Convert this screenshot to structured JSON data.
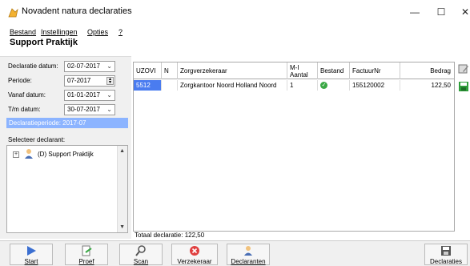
{
  "window": {
    "title": "Novadent natura declaraties",
    "minimize": "—",
    "maximize": "☐",
    "close": "✕"
  },
  "menu": {
    "items": [
      "Bestand",
      "Instellingen",
      "Opties",
      "?"
    ]
  },
  "page": {
    "title": "Support Praktijk"
  },
  "form": {
    "declaratie_datum_label": "Declaratie datum:",
    "declaratie_datum_value": "02-07-2017",
    "periode_label": "Periode:",
    "periode_value": "07-2017",
    "vanaf_datum_label": "Vanaf datum:",
    "vanaf_datum_value": "01-01-2017",
    "tm_datum_label": "T/m datum:",
    "tm_datum_value": "30-07-2017",
    "declaratieperiode": "Declaratieperiode: 2017-07",
    "select_label": "Selecteer declarant:",
    "tree_plus": "+",
    "tree_item": "(D) Support Praktijk"
  },
  "grid": {
    "headers": [
      "UZOVI",
      "N",
      "Zorgverzekeraar",
      "M-I Aantal",
      "Bestand",
      "FactuurNr",
      "Bedrag"
    ],
    "rows": [
      {
        "uzovi": "5512",
        "n": "",
        "zorgverzekeraar": "Zorgkantoor Noord Holland Noord",
        "aantal": "1",
        "bestand": "✓",
        "factuurnr": "155120002",
        "bedrag": "122,50"
      }
    ]
  },
  "total": {
    "label": "Totaal declaratie: 122,50"
  },
  "toolbar": {
    "start": "Start",
    "proef": "Proef",
    "scan": "Scan",
    "verzekeraar": "Verzekeraar",
    "declaranten": "Declaranten",
    "declaraties": "Declaraties"
  },
  "colors": {
    "selection": "#4a7cf0",
    "period_bar": "#8cb4ff",
    "ok_green": "#3aa845"
  }
}
